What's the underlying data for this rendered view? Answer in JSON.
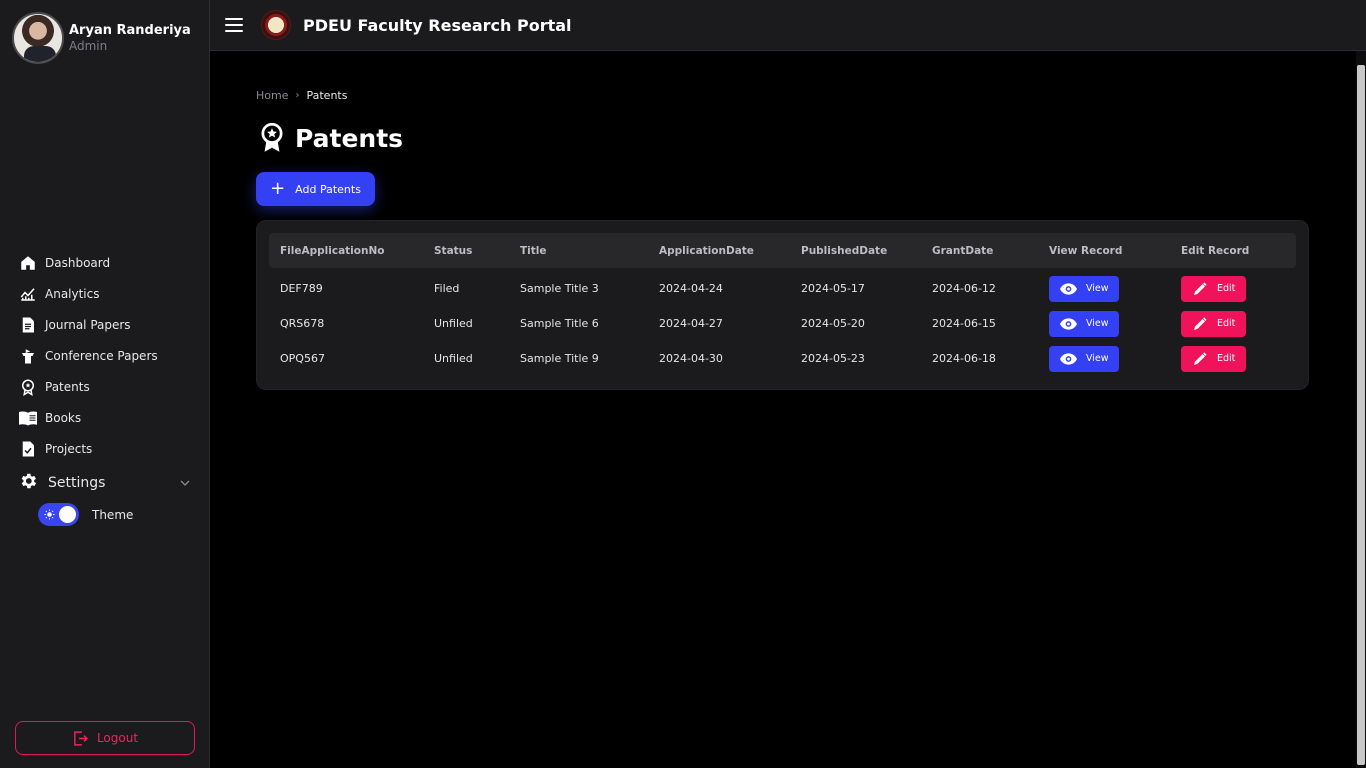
{
  "user": {
    "name": "Aryan Randeriya",
    "role": "Admin"
  },
  "app": {
    "title": "PDEU Faculty Research Portal"
  },
  "sidebar": {
    "items": [
      {
        "label": "Dashboard",
        "icon": "home-icon"
      },
      {
        "label": "Analytics",
        "icon": "analytics-icon"
      },
      {
        "label": "Journal Papers",
        "icon": "document-icon"
      },
      {
        "label": "Conference Papers",
        "icon": "podium-icon"
      },
      {
        "label": "Patents",
        "icon": "award-icon"
      },
      {
        "label": "Books",
        "icon": "book-icon"
      },
      {
        "label": "Projects",
        "icon": "clipboard-check-icon"
      }
    ],
    "settings_label": "Settings",
    "theme_label": "Theme",
    "logout_label": "Logout"
  },
  "breadcrumb": {
    "home": "Home",
    "current": "Patents"
  },
  "page": {
    "title": "Patents",
    "add_button": "Add Patents"
  },
  "table": {
    "headers": [
      "FileApplicationNo",
      "Status",
      "Title",
      "ApplicationDate",
      "PublishedDate",
      "GrantDate",
      "View Record",
      "Edit Record"
    ],
    "view_label": "View",
    "edit_label": "Edit",
    "rows": [
      [
        "DEF789",
        "Filed",
        "Sample Title 3",
        "2024-04-24",
        "2024-05-17",
        "2024-06-12"
      ],
      [
        "QRS678",
        "Unfiled",
        "Sample Title 6",
        "2024-04-27",
        "2024-05-20",
        "2024-06-15"
      ],
      [
        "OPQ567",
        "Unfiled",
        "Sample Title 9",
        "2024-04-30",
        "2024-05-23",
        "2024-06-18"
      ]
    ]
  },
  "colors": {
    "accent": "#3340f4",
    "danger": "#f0125a",
    "sidebar_bg": "#1b1b1d",
    "page_bg": "#000000"
  }
}
